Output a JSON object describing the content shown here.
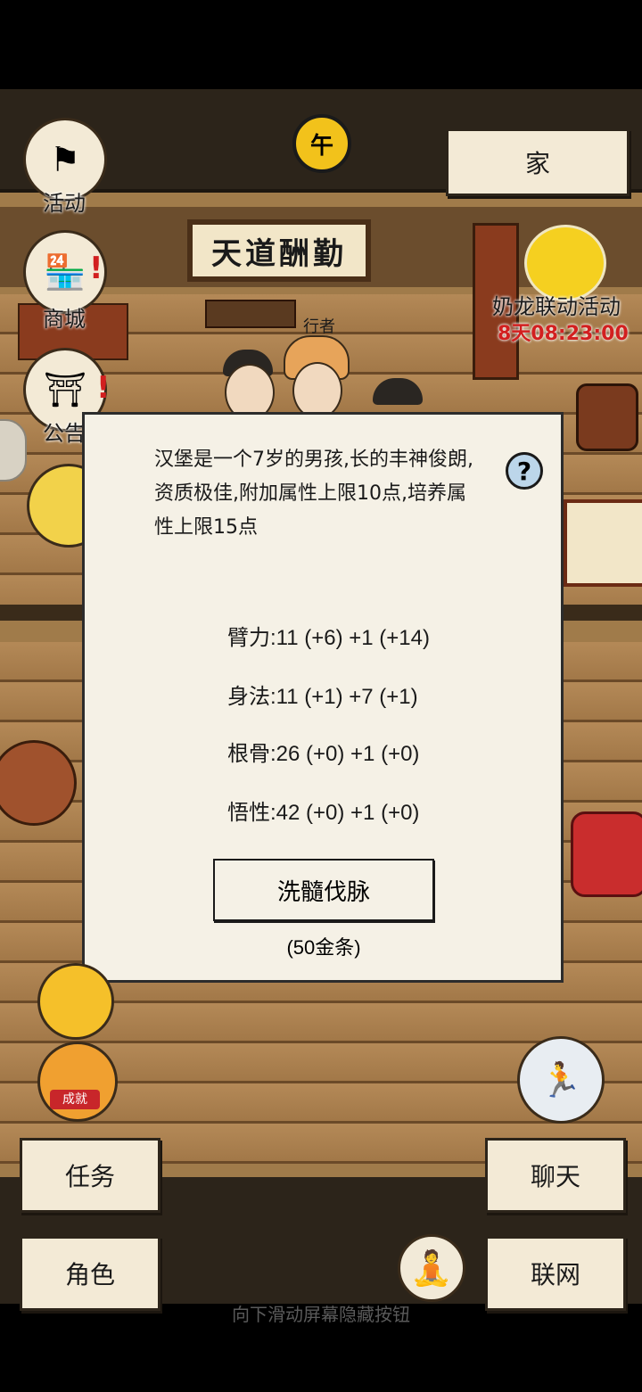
{
  "top": {
    "time_label": "午",
    "home_button": "家"
  },
  "left_menu": {
    "activity": "活动",
    "shop": "商城",
    "notice": "公告"
  },
  "scene": {
    "sign": "天道酬勤",
    "npc_label": "行者"
  },
  "event": {
    "title": "奶龙联动活动",
    "countdown": "8天08:23:00"
  },
  "dialog": {
    "description": "汉堡是一个7岁的男孩,长的丰神俊朗,资质极佳,附加属性上限10点,培养属性上限15点",
    "help_symbol": "?",
    "stats": [
      "臂力:11 (+6) +1 (+14)",
      "身法:11 (+1) +7 (+1)",
      "根骨:26 (+0) +1 (+0)",
      "悟性:42 (+0) +1 (+0)"
    ],
    "action_button": "洗髓伐脉",
    "cost": "(50金条)"
  },
  "achievement_badge": "成就",
  "bottom": {
    "task": "任务",
    "chat": "聊天",
    "role": "角色",
    "network": "联网"
  },
  "system_hint": "向下滑动屏幕隐藏按钮",
  "colors": {
    "panel_bg": "#f5f1e6",
    "frame_dark": "#2c241a",
    "countdown_red": "#d21f1f",
    "floor_wood": "#a07b4a"
  }
}
